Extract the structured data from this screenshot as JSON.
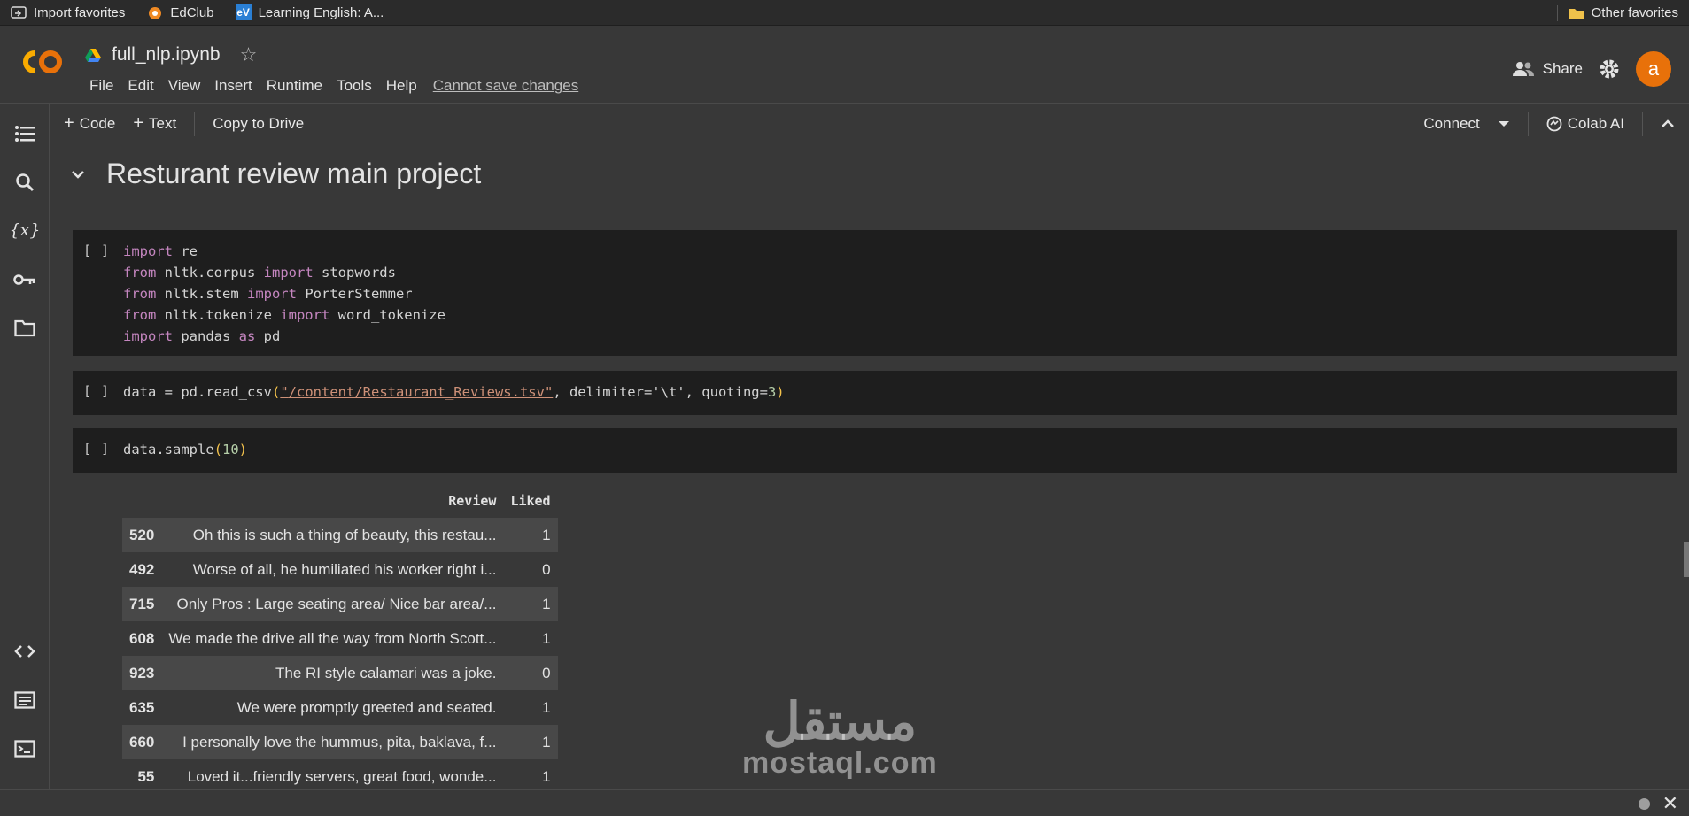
{
  "favorites": {
    "items": [
      {
        "label": "Import favorites",
        "icon": "import-favorites-icon"
      },
      {
        "label": "EdClub",
        "icon": "edclub-icon"
      },
      {
        "label": "Learning English: A...",
        "icon": "ev-icon"
      }
    ],
    "other": "Other favorites"
  },
  "header": {
    "logo_text": "CO",
    "notebook_title": "full_nlp.ipynb",
    "menu": [
      "File",
      "Edit",
      "View",
      "Insert",
      "Runtime",
      "Tools",
      "Help"
    ],
    "save_warning": "Cannot save changes",
    "share_label": "Share",
    "avatar_letter": "a"
  },
  "toolbar": {
    "code_label": "Code",
    "text_label": "Text",
    "copy_label": "Copy to Drive",
    "connect_label": "Connect",
    "colab_ai_label": "Colab AI"
  },
  "section_title": "Resturant review main project",
  "cells": [
    {
      "run_label": "[ ]"
    },
    {
      "run_label": "[ ]"
    },
    {
      "run_label": "[ ]"
    }
  ],
  "code": {
    "c1": {
      "l1": {
        "kw": "import",
        "rest": " re"
      },
      "l2": {
        "kw1": "from",
        "mid": " nltk.corpus ",
        "kw2": "import",
        "rest": " stopwords"
      },
      "l3": {
        "kw1": "from",
        "mid": " nltk.stem ",
        "kw2": "import",
        "rest": " PorterStemmer"
      },
      "l4": {
        "kw1": "from",
        "mid": " nltk.tokenize ",
        "kw2": "import",
        "rest": " word_tokenize"
      },
      "l5": {
        "kw1": "import",
        "mid": " pandas ",
        "kw2": "as",
        "rest": " pd"
      }
    },
    "c2": {
      "pre": "data = pd.read_csv",
      "open": "(",
      "q1": "\"",
      "path": "/content/Restaurant_Reviews.tsv",
      "q2": "\"",
      "mid": ", delimiter='\\t', quoting=",
      "num": "3",
      "close": ")"
    },
    "c3": {
      "pre": "data.sample",
      "open": "(",
      "num": "10",
      "close": ")"
    }
  },
  "dataframe": {
    "columns": [
      "Review",
      "Liked"
    ],
    "rows": [
      {
        "index": "520",
        "review": "Oh this is such a thing of beauty, this restau...",
        "liked": "1"
      },
      {
        "index": "492",
        "review": "Worse of all, he humiliated his worker right i...",
        "liked": "0"
      },
      {
        "index": "715",
        "review": "Only Pros : Large seating area/ Nice bar area/...",
        "liked": "1"
      },
      {
        "index": "608",
        "review": "We made the drive all the way from North Scott...",
        "liked": "1"
      },
      {
        "index": "923",
        "review": "The RI style calamari was a joke.",
        "liked": "0"
      },
      {
        "index": "635",
        "review": "We were promptly greeted and seated.",
        "liked": "1"
      },
      {
        "index": "660",
        "review": "I personally love the hummus, pita, baklava, f...",
        "liked": "1"
      },
      {
        "index": "55",
        "review": "Loved it...friendly servers, great food, wonde...",
        "liked": "1"
      }
    ]
  },
  "watermark": {
    "arabic": "مستقل",
    "latin": "mostaql.com"
  },
  "colors": {
    "accent": "#e8710a",
    "background": "#383838",
    "cell_bg": "#1e1e1e",
    "keyword": "#c586c0",
    "string": "#ce9178"
  }
}
